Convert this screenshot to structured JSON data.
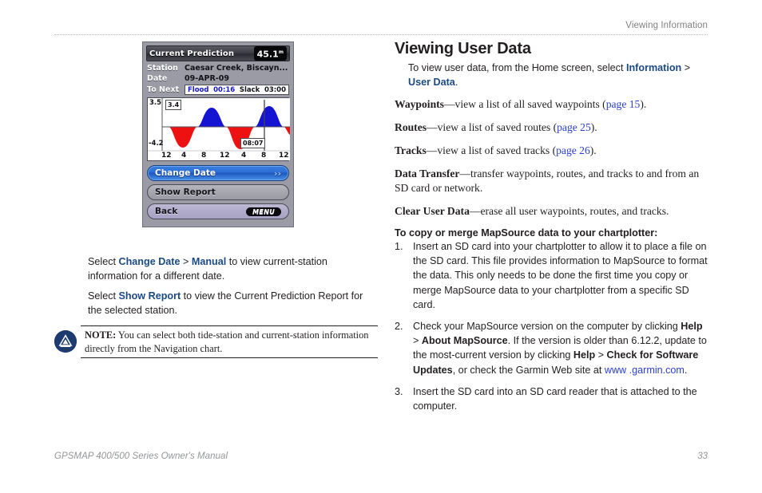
{
  "header": {
    "running_head": "Viewing Information"
  },
  "footer": {
    "manual_title": "GPSMAP 400/500 Series Owner's Manual",
    "page_number": "33"
  },
  "device_screenshot": {
    "title": "Current Prediction",
    "badge_value": "45.1",
    "badge_unit": "m",
    "fields": [
      {
        "label": "Station",
        "value": "Caesar Creek, Biscayn..."
      },
      {
        "label": "Date",
        "value": "09-APR-09"
      }
    ],
    "to_next": {
      "label": "To Next",
      "state_label": "Flood",
      "state_time": "00:16",
      "slack_label": "Slack",
      "slack_time": "03:00"
    },
    "chart": {
      "y_max_label": "3.5",
      "y_min_label": "-4.2",
      "value_box": "3.4",
      "time_box": "08:07",
      "x_ticks": [
        "12",
        "4",
        "8",
        "12",
        "4",
        "8",
        "12"
      ]
    },
    "buttons": [
      {
        "label": "Change Date",
        "accessory": "chevron-right",
        "style": "primary"
      },
      {
        "label": "Show Report",
        "accessory": "",
        "style": "plain"
      },
      {
        "label": "Back",
        "accessory": "MENU",
        "style": "back"
      }
    ]
  },
  "left_column": {
    "para1": {
      "pre": "Select ",
      "b1": "Change Date",
      "mid": " > ",
      "b2": "Manual",
      "post": " to view current-station information for a different date."
    },
    "para2": {
      "pre": "Select ",
      "b1": "Show Report",
      "post": " to view the Current Prediction Report for the selected station."
    },
    "note": {
      "label": "NOTE:",
      "text": " You can select both tide-station and current-station information directly from the Navigation chart."
    }
  },
  "right_column": {
    "heading": "Viewing User Data",
    "intro": {
      "pre": "To view user data, from the Home screen, select ",
      "b1": "Information",
      "mid": " > ",
      "b2": "User Data",
      "post": "."
    },
    "definitions": [
      {
        "term": "Waypoints",
        "dash": "—",
        "text_before": "view a list of all saved waypoints (",
        "link": "page 15",
        "text_after": ")."
      },
      {
        "term": "Routes",
        "dash": "—",
        "text_before": "view a list of saved routes (",
        "link": "page 25",
        "text_after": ")."
      },
      {
        "term": "Tracks",
        "dash": "—",
        "text_before": "view a list of saved tracks (",
        "link": "page 26",
        "text_after": ")."
      },
      {
        "term": "Data Transfer",
        "dash": "—",
        "text_before": "transfer waypoints, routes, and tracks to and from an SD card or network.",
        "link": "",
        "text_after": ""
      },
      {
        "term": "Clear User Data",
        "dash": "—",
        "text_before": "erase all user waypoints, routes, and tracks.",
        "link": "",
        "text_after": ""
      }
    ],
    "procedure_heading": "To copy or merge MapSource data to your chartplotter:",
    "steps": [
      {
        "num": "1.",
        "parts": [
          {
            "t": "Insert an SD card into your chartplotter to allow it to place a file on the SD card. This file provides information to MapSource to format the data. This only needs to be done the first time you copy or merge MapSource data to your chartplotter from a specific SD card.",
            "s": "normal"
          }
        ]
      },
      {
        "num": "2.",
        "parts": [
          {
            "t": "Check your MapSource version on the computer by clicking ",
            "s": "normal"
          },
          {
            "t": "Help",
            "s": "bold"
          },
          {
            "t": " > ",
            "s": "normal"
          },
          {
            "t": "About MapSource",
            "s": "bold"
          },
          {
            "t": ". If the version is older than 6.12.2, update to the most-current version by clicking ",
            "s": "normal"
          },
          {
            "t": "Help",
            "s": "bold"
          },
          {
            "t": " > ",
            "s": "normal"
          },
          {
            "t": "Check for Software Updates",
            "s": "bold"
          },
          {
            "t": ", or check the Garmin Web site at ",
            "s": "normal"
          },
          {
            "t": "www .garmin.com",
            "s": "link"
          },
          {
            "t": ".",
            "s": "normal"
          }
        ]
      },
      {
        "num": "3.",
        "parts": [
          {
            "t": "Insert the SD card into an SD card reader that is attached to the computer.",
            "s": "normal"
          }
        ]
      }
    ]
  },
  "colors": {
    "link": "#2a3fd0",
    "ui_bold": "#1b4a82",
    "text": "#231f20",
    "muted": "#939598",
    "note_icon": "#1d3b6e"
  }
}
